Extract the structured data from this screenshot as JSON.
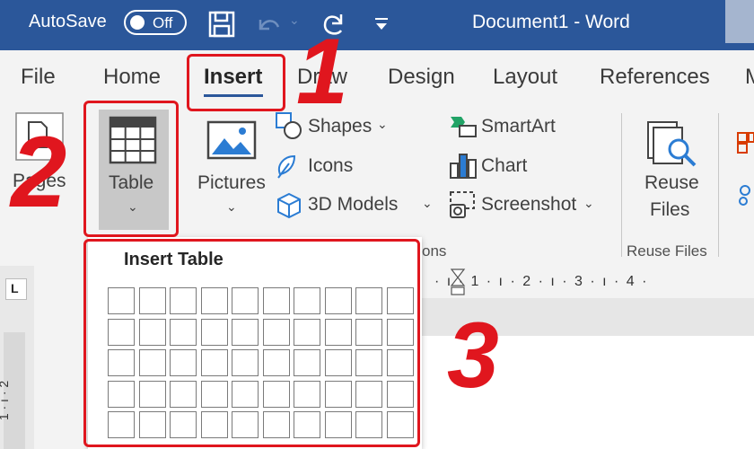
{
  "titlebar": {
    "autosave_label": "AutoSave",
    "autosave_state": "Off",
    "doc_title": "Document1  -  Word"
  },
  "tabs": [
    "File",
    "Home",
    "Insert",
    "Draw",
    "Design",
    "Layout",
    "References"
  ],
  "ribbon": {
    "pages_label": "Pages",
    "table_label": "Table",
    "pictures_label": "Pictures",
    "shapes_label": "Shapes",
    "icons_label": "Icons",
    "models_label": "3D Models",
    "smartart_label": "SmartArt",
    "chart_label": "Chart",
    "screenshot_label": "Screenshot",
    "reuse_label_1": "Reuse",
    "reuse_label_2": "Files",
    "reuse_group": "Reuse Files",
    "illustrations_group_fragment": "ons"
  },
  "ruler": {
    "ticks": "· ı · 1 · ı · 2 · ı · 3 · ı · 4 ·",
    "left_ticks": "1 · ı · 2"
  },
  "dropdown": {
    "title": "Insert Table",
    "rows_visible": 5,
    "cols": 10
  },
  "annotations": {
    "step1": "1",
    "step2": "2",
    "step3": "3",
    "color": "#e0161e"
  }
}
